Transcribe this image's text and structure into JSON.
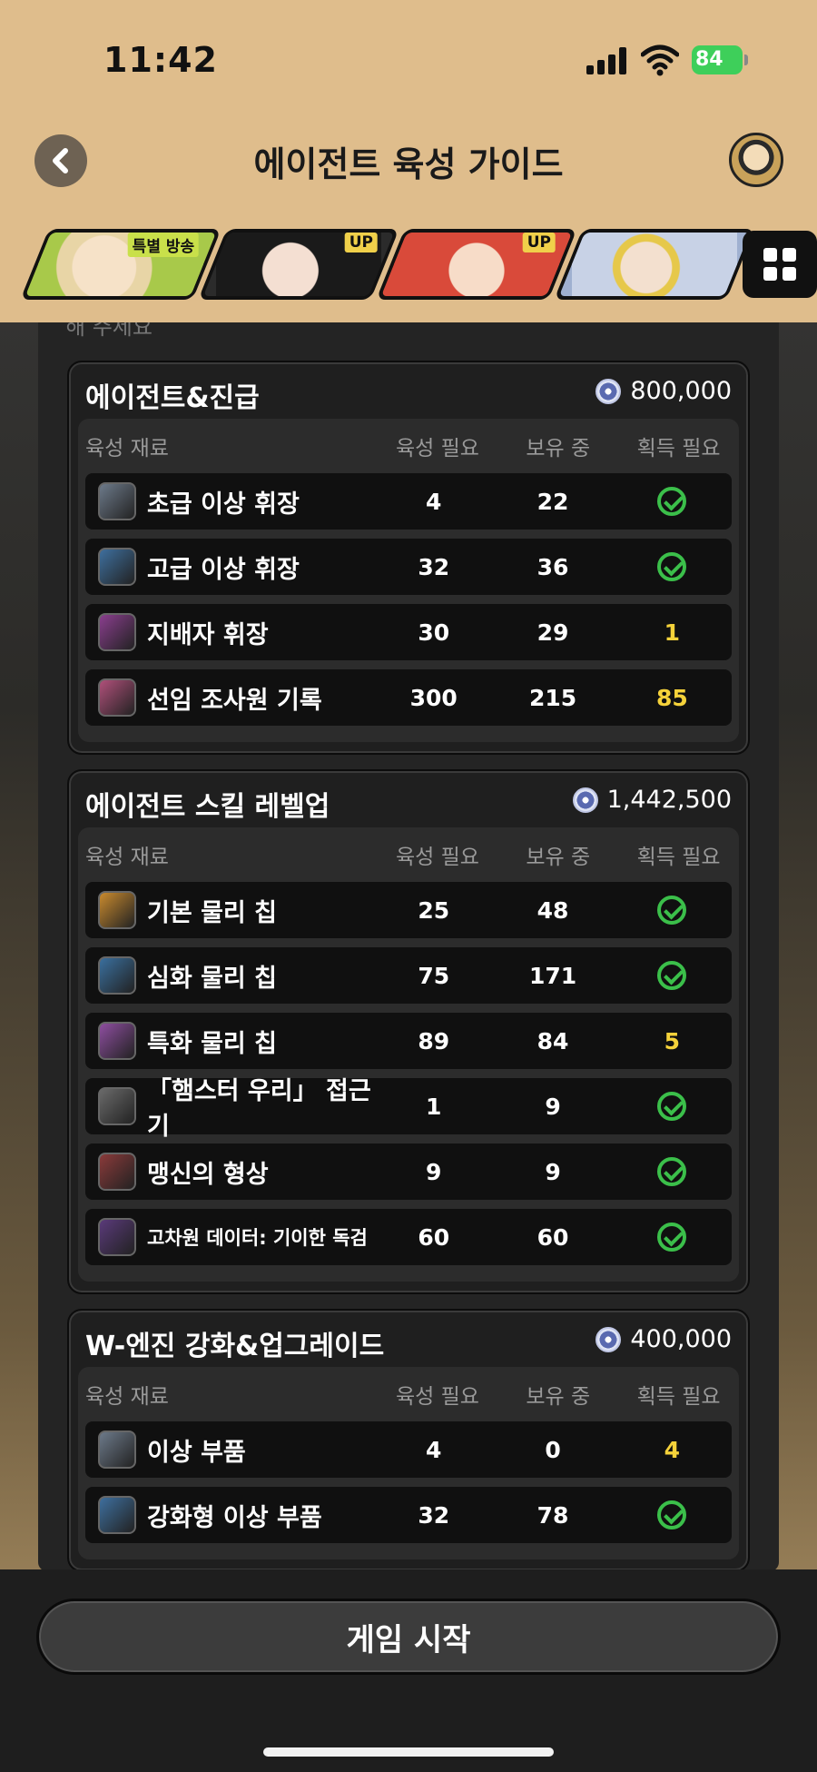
{
  "status": {
    "time": "11:42",
    "battery": "84"
  },
  "nav": {
    "title": "에이전트 육성 가이드"
  },
  "agents": [
    {
      "badge": "특별 방송",
      "color": "#a8c94a"
    },
    {
      "badge": "UP",
      "color": "#2b2b2b"
    },
    {
      "badge": "UP",
      "color": "#d94a3a"
    },
    {
      "badge": "",
      "color": "#9fb0d0"
    }
  ],
  "hint": "해 주세요",
  "columns": {
    "material": "육성 재료",
    "required": "육성 필요",
    "owned": "보유 중",
    "needed": "획득 필요"
  },
  "sections": [
    {
      "title": "에이전트&진급",
      "cost": "800,000",
      "rows": [
        {
          "name": "초급 이상 휘장",
          "required": "4",
          "owned": "22",
          "needed": ""
        },
        {
          "name": "고급 이상 휘장",
          "required": "32",
          "owned": "36",
          "needed": ""
        },
        {
          "name": "지배자 휘장",
          "required": "30",
          "owned": "29",
          "needed": "1"
        },
        {
          "name": "선임 조사원 기록",
          "required": "300",
          "owned": "215",
          "needed": "85"
        }
      ]
    },
    {
      "title": "에이전트 스킬 레벨업",
      "cost": "1,442,500",
      "rows": [
        {
          "name": "기본 물리 칩",
          "required": "25",
          "owned": "48",
          "needed": ""
        },
        {
          "name": "심화 물리 칩",
          "required": "75",
          "owned": "171",
          "needed": ""
        },
        {
          "name": "특화 물리 칩",
          "required": "89",
          "owned": "84",
          "needed": "5"
        },
        {
          "name": "「햄스터 우리」 접근기",
          "required": "1",
          "owned": "9",
          "needed": ""
        },
        {
          "name": "맹신의 형상",
          "required": "9",
          "owned": "9",
          "needed": ""
        },
        {
          "name": "고차원 데이터: 기이한 독검",
          "required": "60",
          "owned": "60",
          "needed": ""
        }
      ]
    },
    {
      "title": "W-엔진 강화&업그레이드",
      "cost": "400,000",
      "rows": [
        {
          "name": "이상 부품",
          "required": "4",
          "owned": "0",
          "needed": "4"
        },
        {
          "name": "강화형 이상 부품",
          "required": "32",
          "owned": "78",
          "needed": ""
        }
      ]
    }
  ],
  "start_button": "게임 시작"
}
